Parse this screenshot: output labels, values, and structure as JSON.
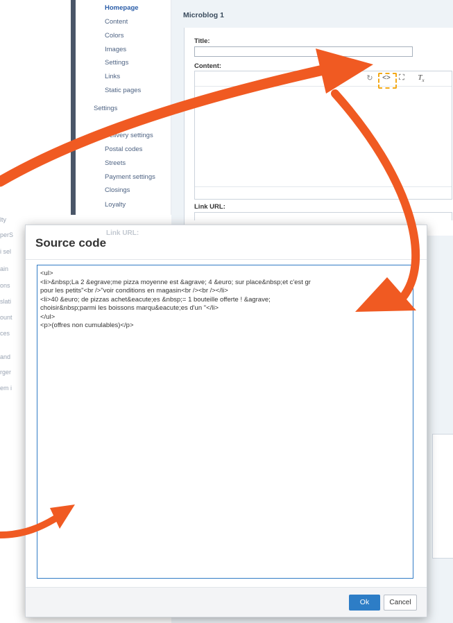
{
  "sidebar": {
    "items": [
      {
        "label": "Homepage",
        "active": true
      },
      {
        "label": "Content"
      },
      {
        "label": "Colors"
      },
      {
        "label": "Images"
      },
      {
        "label": "Settings"
      },
      {
        "label": "Links"
      },
      {
        "label": "Static pages"
      }
    ],
    "group_label": "Settings",
    "settings_items": [
      {
        "label": "Delivery settings"
      },
      {
        "label": "Postal codes"
      },
      {
        "label": "Streets"
      },
      {
        "label": "Payment settings"
      },
      {
        "label": "Closings"
      },
      {
        "label": "Loyalty"
      }
    ]
  },
  "left_ghost_fragments": [
    "lty",
    "perS",
    "i sel",
    "ain",
    "ons",
    "slati",
    "ount",
    "ces",
    "and",
    "rger",
    "em i"
  ],
  "panel": {
    "title": "Microblog 1",
    "title_label": "Title:",
    "content_label": "Content:",
    "link_url_label": "Link URL:",
    "toolbar_icons": [
      "redo-icon",
      "source-code-icon",
      "fullscreen-icon",
      "clear-formatting-icon"
    ]
  },
  "modal": {
    "ghost_label": "Link URL:",
    "title": "Source code",
    "close_glyph": "×",
    "code_lines": [
      "<ul>",
      "<li>&nbsp;La 2 &egrave;me pizza moyenne est &agrave; 4 &euro; sur place&nbsp;et c'est gr",
      "pour les petits\"<br />\"voir conditions en magasin<br /><br /></li>",
      "<li>40 &euro; de pizzas achet&eacute;es &nbsp;= 1 bouteille offerte ! &agrave;",
      "choisir&nbsp;parmi les boissons marqu&eacute;es d'un \"</li>",
      "</ul>",
      "<p>(offres non cumulables)</p>"
    ],
    "ok_label": "Ok",
    "cancel_label": "Cancel"
  },
  "colors": {
    "arrow": "#f05a22",
    "highlight": "#f3a918",
    "ok_button": "#2d7dc6",
    "code_border": "#2f7ac5"
  }
}
